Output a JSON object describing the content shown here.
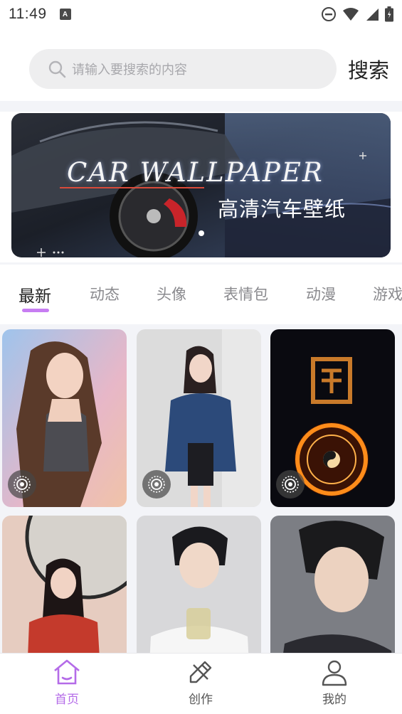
{
  "status_bar": {
    "time": "11:49",
    "badge": "A"
  },
  "search": {
    "placeholder": "请输入要搜索的内容",
    "button_label": "搜索"
  },
  "banner": {
    "title": "CAR WALLPAPER",
    "subtitle": "高清汽车壁纸"
  },
  "tabs": [
    {
      "label": "最新",
      "active": true
    },
    {
      "label": "动态"
    },
    {
      "label": "头像"
    },
    {
      "label": "表情包"
    },
    {
      "label": "动漫"
    },
    {
      "label": "游戏"
    }
  ],
  "bottom_nav": [
    {
      "label": "首页",
      "icon": "home-icon",
      "active": true
    },
    {
      "label": "创作",
      "icon": "create-icon"
    },
    {
      "label": "我的",
      "icon": "profile-icon"
    }
  ],
  "colors": {
    "accent": "#c77df2",
    "active_nav": "#b46be8",
    "background": "#f3f4f8"
  }
}
